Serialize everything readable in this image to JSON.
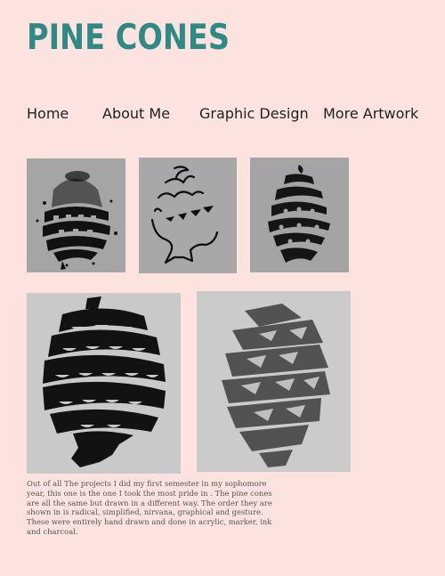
{
  "page": {
    "title": "PINE CONES"
  },
  "nav": {
    "items": [
      {
        "label": "Home"
      },
      {
        "label": "About Me"
      },
      {
        "label": "Graphic Design"
      },
      {
        "label": "More Artwork"
      }
    ]
  },
  "gallery": {
    "images": [
      {
        "name": "radical"
      },
      {
        "name": "simplified"
      },
      {
        "name": "nirvana"
      },
      {
        "name": "graphical"
      },
      {
        "name": "gesture"
      }
    ]
  },
  "caption": {
    "text": "Out of all The projects I did my first semester in my sophomore year, this one is the one I took the most pride in . The pine cones are all the same but drawn in a different way. The order they are shown in is radical, simplified, nirvana, graphical and gesture. These were entirely hand drawn and done in acrylic, marker, ink and charcoal."
  },
  "colors": {
    "background": "#fde3df",
    "title": "#2f8a86",
    "nav_text": "#1f1f1f",
    "caption_text": "#555555"
  }
}
